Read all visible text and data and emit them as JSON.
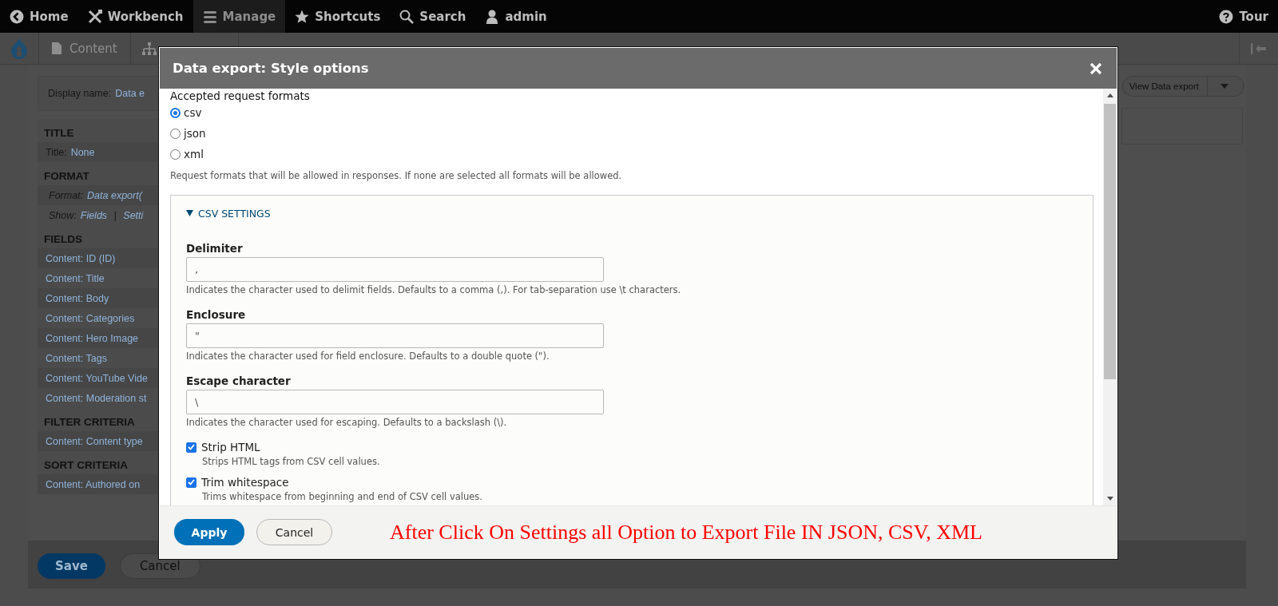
{
  "toolbar": {
    "items": [
      {
        "label": "Home",
        "selected": false
      },
      {
        "label": "Workbench",
        "selected": false
      },
      {
        "label": "Manage",
        "selected": true
      },
      {
        "label": "Shortcuts",
        "selected": false
      },
      {
        "label": "Search",
        "selected": false
      },
      {
        "label": "admin",
        "selected": false
      }
    ],
    "tour": {
      "label": "Tour"
    }
  },
  "tray": {
    "items": [
      {
        "label": "Content"
      }
    ]
  },
  "view": {
    "display_name_label": "Display name:",
    "display_name_value": "Data e",
    "sections": [
      {
        "title": "TITLE",
        "rows": [
          {
            "kind": "pair",
            "label": "Title:",
            "value": "None"
          }
        ]
      },
      {
        "title": "FORMAT",
        "rows": [
          {
            "kind": "italic",
            "label": "Format:",
            "value": "Data export("
          },
          {
            "kind": "links",
            "label": "Show:",
            "links": [
              "Fields",
              "Setti"
            ],
            "separator": "|"
          }
        ]
      },
      {
        "title": "FIELDS",
        "rows": [
          {
            "kind": "link",
            "value": "Content: ID (ID)"
          },
          {
            "kind": "link",
            "value": "Content: Title"
          },
          {
            "kind": "link",
            "value": "Content: Body"
          },
          {
            "kind": "link",
            "value": "Content: Categories"
          },
          {
            "kind": "link",
            "value": "Content: Hero Image"
          },
          {
            "kind": "link",
            "value": "Content: Tags"
          },
          {
            "kind": "link",
            "value": "Content: YouTube Vide"
          },
          {
            "kind": "link",
            "value": "Content: Moderation st"
          }
        ]
      },
      {
        "title": "FILTER CRITERIA",
        "rows": [
          {
            "kind": "link",
            "value": "Content: Content type"
          }
        ]
      },
      {
        "title": "SORT CRITERIA",
        "rows": [
          {
            "kind": "link",
            "value": "Content: Authored on"
          }
        ]
      }
    ],
    "view_button": "View Data export",
    "buttons": [
      "Save",
      "Cancel"
    ]
  },
  "modal": {
    "title": "Data export: Style options",
    "formats": {
      "label": "Accepted request formats",
      "options": [
        {
          "label": "csv",
          "selected": true
        },
        {
          "label": "json",
          "selected": false
        },
        {
          "label": "xml",
          "selected": false
        }
      ],
      "description": "Request formats that will be allowed in responses. If none are selected all formats will be allowed."
    },
    "fieldset": {
      "title": "CSV SETTINGS",
      "expanded": true,
      "fields": [
        {
          "label": "Delimiter",
          "value": ",",
          "description": "Indicates the character used to delimit fields. Defaults to a comma (,). For tab-separation use \\t characters."
        },
        {
          "label": "Enclosure",
          "value": "\"",
          "description": "Indicates the character used for field enclosure. Defaults to a double quote (\")."
        },
        {
          "label": "Escape character",
          "value": "\\",
          "description": "Indicates the character used for escaping. Defaults to a backslash (\\)."
        }
      ],
      "checkboxes": [
        {
          "label": "Strip HTML",
          "checked": true,
          "description": "Strips HTML tags from CSV cell values."
        },
        {
          "label": "Trim whitespace",
          "checked": true,
          "description": "Trims whitespace from beginning and end of CSV cell values."
        }
      ]
    },
    "buttons": [
      "Apply",
      "Cancel"
    ],
    "annotation": "After Click On Settings all Option to Export File IN JSON, CSV, XML"
  }
}
